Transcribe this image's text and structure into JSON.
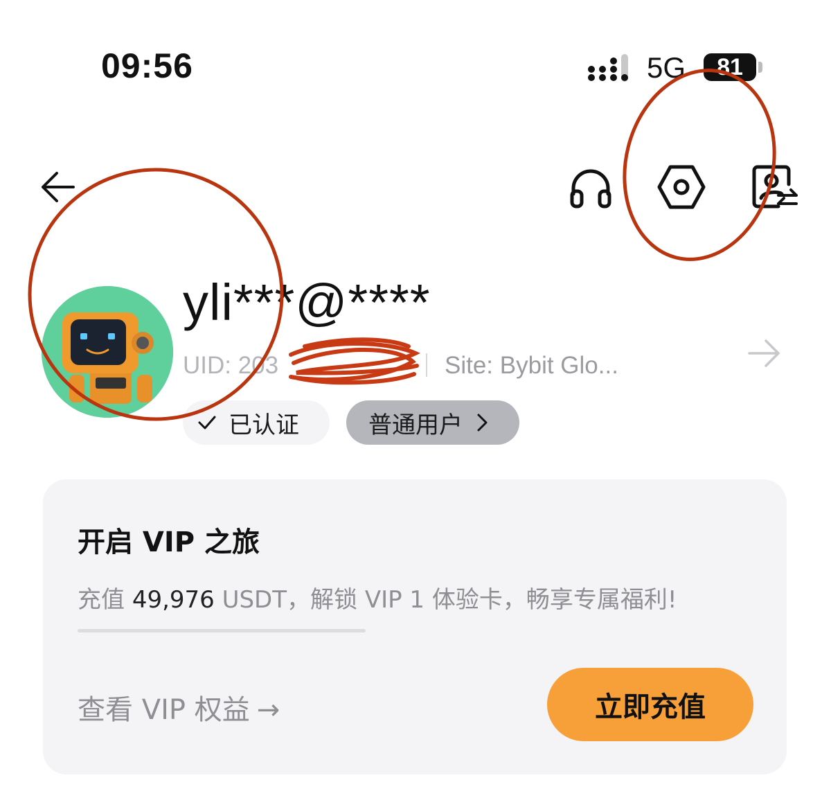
{
  "status_bar": {
    "time": "09:56",
    "network": "5G",
    "battery": "81"
  },
  "nav": {
    "back_icon": "arrow-left-icon",
    "support_icon": "headset-icon",
    "settings_icon": "settings-hexagon-icon",
    "switch_account_icon": "switch-account-icon"
  },
  "profile": {
    "avatar": "robot-avatar",
    "username": "yli***@****",
    "uid_label": "UID: 203",
    "site_label": "Site: Bybit Glo...",
    "verified_label": "已认证",
    "level_label": "普通用户"
  },
  "vip": {
    "title": "开启 VIP 之旅",
    "desc_prefix": "充值 ",
    "desc_amount": "49,976",
    "desc_suffix": " USDT，解锁 VIP 1 体验卡，畅享专属福利!",
    "progress": 0,
    "link_label": "查看 VIP 权益",
    "link_arrow": "→",
    "button_label": "立即充值"
  },
  "colors": {
    "accent_orange": "#F7A03A",
    "annotation_red": "#B8350F",
    "badge_gray": "#B4B6BB",
    "card_bg": "#F4F4F6"
  }
}
